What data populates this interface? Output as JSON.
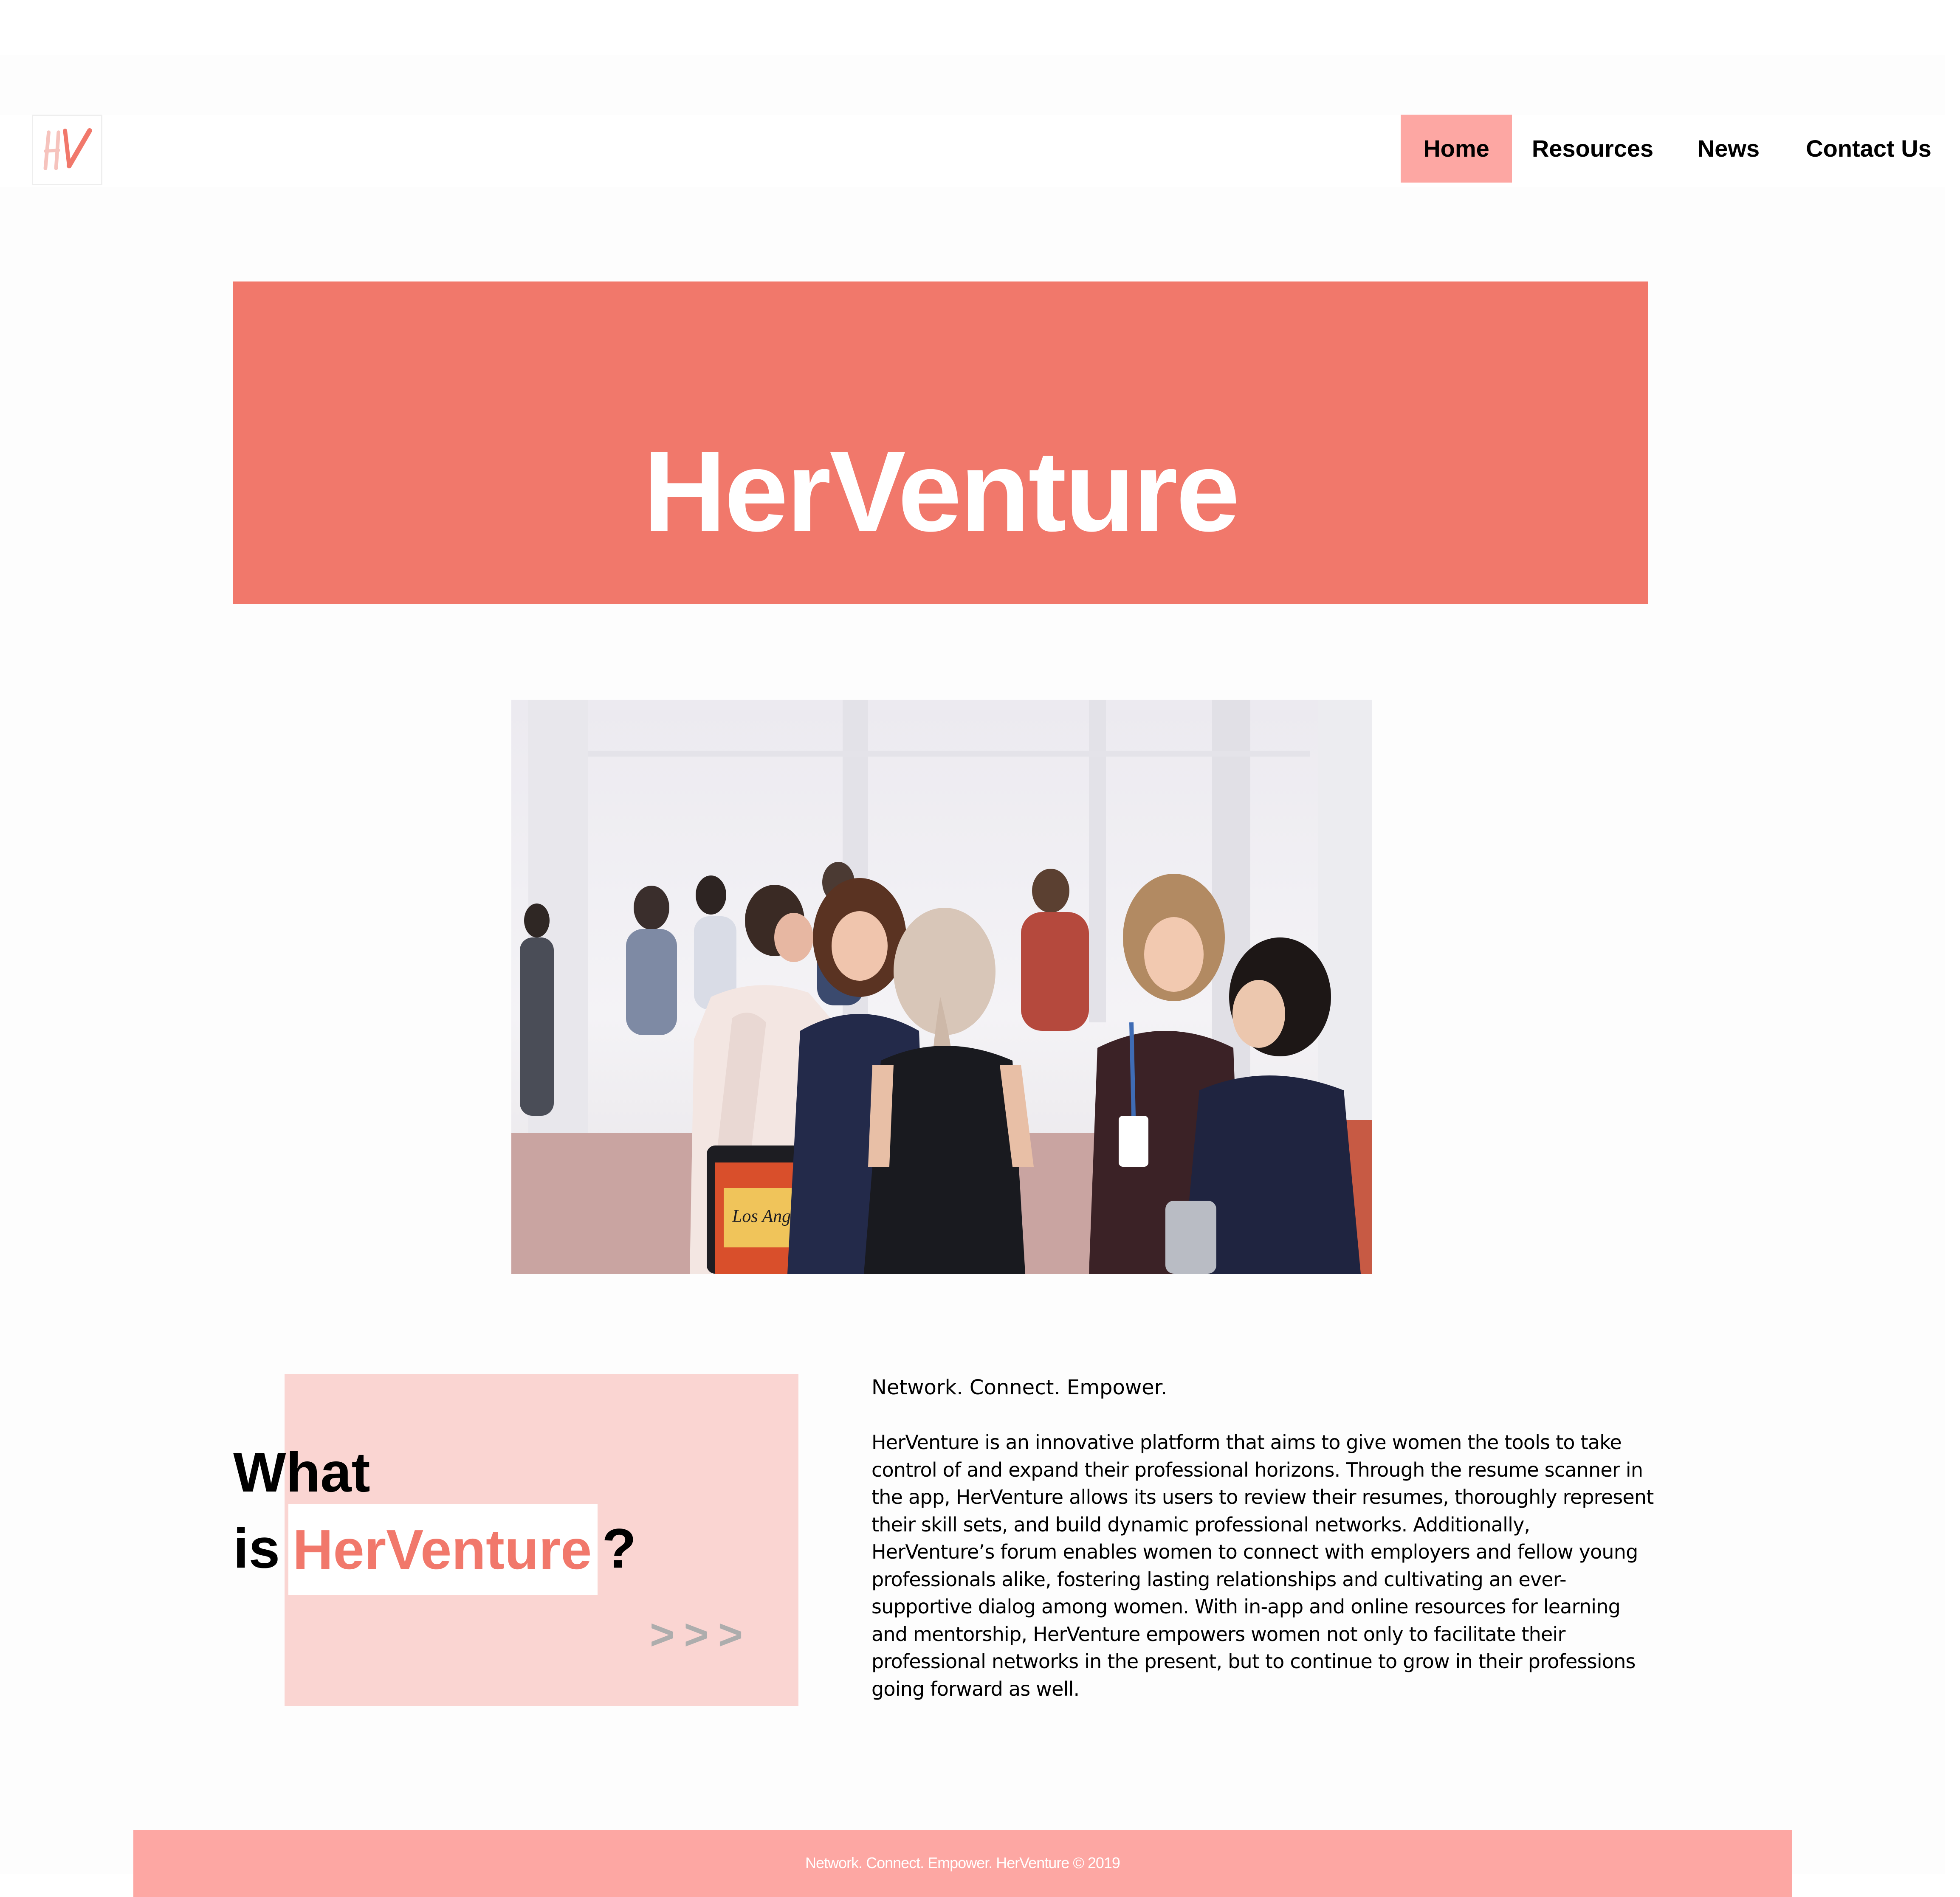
{
  "nav": {
    "logo_text": "HV",
    "items": [
      {
        "label": "Home",
        "active": true
      },
      {
        "label": "Resources",
        "active": false
      },
      {
        "label": "News",
        "active": false
      },
      {
        "label": "Contact Us",
        "active": false
      }
    ]
  },
  "hero": {
    "title": "HerVenture"
  },
  "photo": {
    "badge_text": "Los Angeles"
  },
  "about": {
    "heading_line1": "What",
    "heading_is": "is",
    "heading_brand": "HerVenture",
    "heading_question": "?",
    "more_arrows": ">>>",
    "tagline": "Network. Connect. Empower.",
    "description": "HerVenture is an innovative platform that aims to give women the tools to take control of and expand their professional horizons. Through the resume scanner in the app, HerVenture allows its users to review their resumes, thoroughly represent their skill sets, and build dynamic professional networks. Additionally, HerVenture’s forum enables women to connect with employers and fellow young professionals alike, fostering lasting relationships and cultivating an ever-supportive dialog among women. With in-app and online resources for learning and mentorship, HerVenture empowers women not only to facilitate their professional networks in the present, but to continue to grow in their professions going forward as well."
  },
  "footer": {
    "text": "Network. Connect. Empower. HerVenture © 2019"
  },
  "colors": {
    "coral": "#f1786b",
    "pink": "#fda7a3",
    "light_pink": "#fad5d2",
    "chevron_grey": "#adadad"
  }
}
